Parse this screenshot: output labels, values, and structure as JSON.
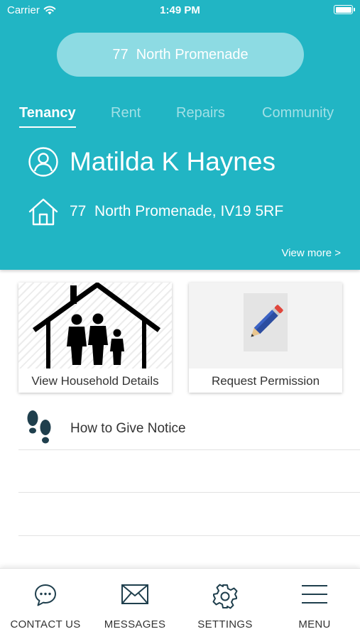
{
  "status_bar": {
    "carrier": "Carrier",
    "time": "1:49 PM",
    "battery_level": 1.0
  },
  "header": {
    "background_color": "#21b5c4",
    "address_pill": "77  North Promenade",
    "tabs": [
      {
        "label": "Tenancy",
        "active": true
      },
      {
        "label": "Rent",
        "active": false
      },
      {
        "label": "Repairs",
        "active": false
      },
      {
        "label": "Community",
        "active": false
      }
    ],
    "tenant_name": "Matilda K Haynes",
    "tenant_address": "77  North Promenade, IV19 5RF",
    "view_more": "View more >"
  },
  "cards": [
    {
      "label": "View Household Details",
      "icon": "family-house-icon"
    },
    {
      "label": "Request Permission",
      "icon": "pencil-icon"
    }
  ],
  "list": {
    "items": [
      {
        "label": "How to Give Notice",
        "icon": "footprints-icon"
      }
    ]
  },
  "bottom_nav": {
    "items": [
      {
        "label": "CONTACT US",
        "icon": "chat-bubble-icon"
      },
      {
        "label": "MESSAGES",
        "icon": "envelope-icon"
      },
      {
        "label": "SETTINGS",
        "icon": "gear-icon"
      },
      {
        "label": "MENU",
        "icon": "hamburger-menu-icon"
      }
    ]
  }
}
